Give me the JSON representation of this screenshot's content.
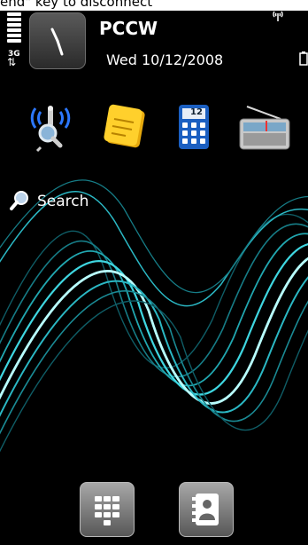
{
  "top_banner": {
    "text": "end\" key to disconnect"
  },
  "status": {
    "operator": "PCCW",
    "date": "Wed 10/12/2008",
    "network_type": "3G",
    "signal_icon": "signal-bars-icon",
    "antenna_icon": "antenna-icon",
    "battery_icon": "battery-icon"
  },
  "shortcuts": [
    {
      "name": "connectivity-icon"
    },
    {
      "name": "notes-icon"
    },
    {
      "name": "calculator-icon",
      "calendar_label": "12"
    },
    {
      "name": "radio-icon"
    }
  ],
  "search": {
    "label": "Search",
    "icon": "search-icon"
  },
  "dock": [
    {
      "name": "dialer-icon"
    },
    {
      "name": "contacts-icon"
    }
  ],
  "colors": {
    "background": "#000000",
    "wave": "#3fd6e0",
    "wave_glow": "#b8ffff"
  }
}
